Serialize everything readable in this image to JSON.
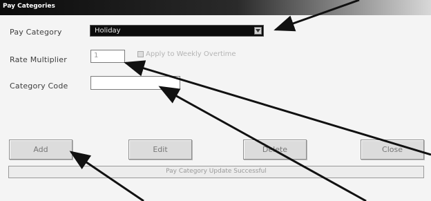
{
  "window": {
    "title": "Pay Categories"
  },
  "form": {
    "pay_category_label": "Pay Category",
    "pay_category_value": "Holiday",
    "rate_multiplier_label": "Rate Multiplier",
    "rate_multiplier_value": "1",
    "apply_overtime_label": "Apply to Weekly Overtime",
    "category_code_label": "Category Code",
    "category_code_value": ""
  },
  "buttons": {
    "add": "Add",
    "edit": "Edit",
    "delete": "Delete",
    "close": "Close"
  },
  "status": {
    "message": "Pay Category Update Successful"
  },
  "annotation": {
    "arrow_color": "#111111"
  }
}
